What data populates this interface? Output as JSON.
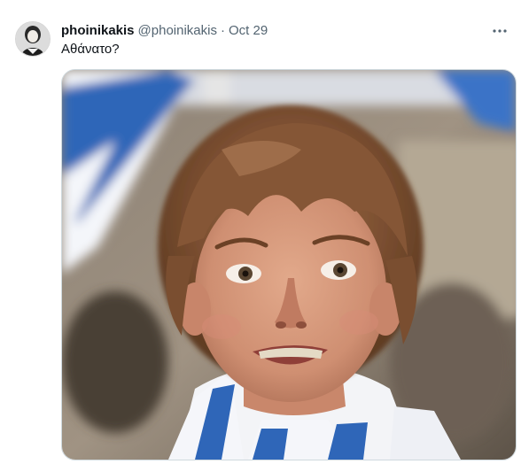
{
  "tweet": {
    "display_name": "phoinikakis",
    "handle": "@phoinikakis",
    "separator": "·",
    "timestamp": "Oct 29",
    "text": "Αθάνατο?",
    "avatar_icon": "profile-avatar",
    "more_icon": "more-horizontal-icon",
    "media": {
      "description_icon": "photo-child-greek-flag"
    }
  },
  "colors": {
    "text_primary": "#0f1419",
    "text_secondary": "#536471",
    "border": "#cfd9de",
    "flag_blue": "#2f66b8"
  }
}
